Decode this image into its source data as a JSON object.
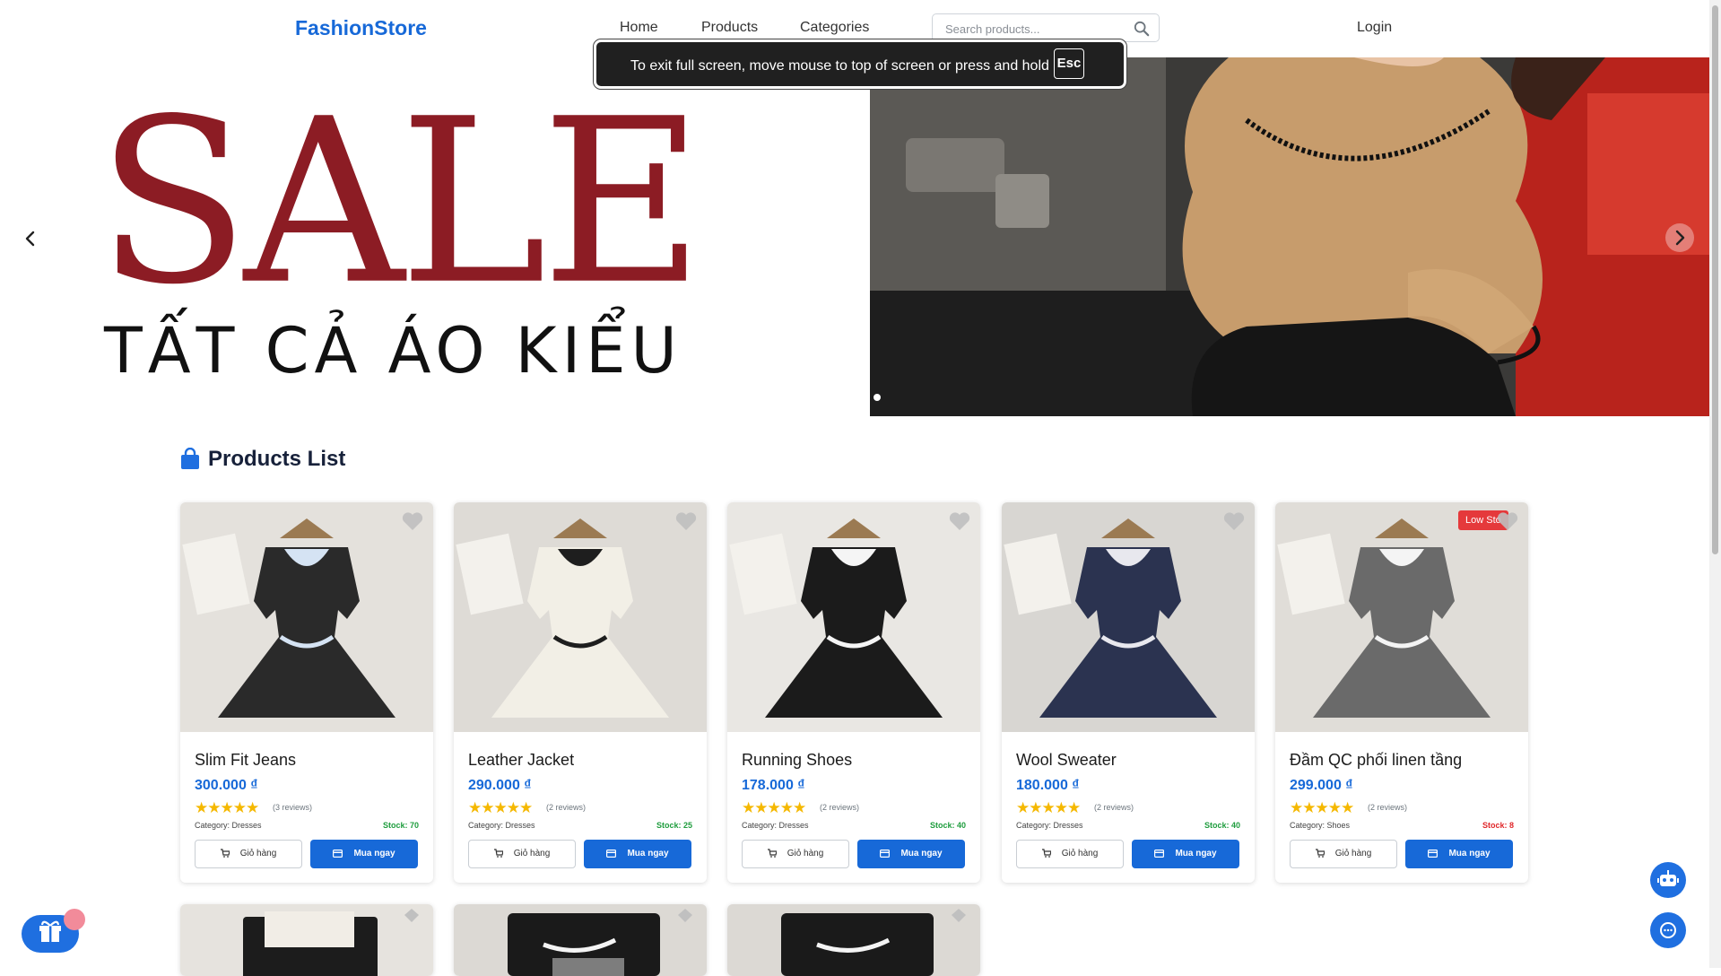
{
  "header": {
    "logo": "FashionStore",
    "nav": [
      "Home",
      "Products",
      "Categories"
    ],
    "search_placeholder": "Search products...",
    "login": "Login"
  },
  "fullscreen_toast": {
    "text": "To exit full screen, move mouse to top of screen or press and hold",
    "key": "Esc"
  },
  "banner": {
    "headline": "SALE",
    "subline": "TẤT CẢ ÁO KIỂU",
    "headline_color": "#8c1c24",
    "active_slide": 1
  },
  "products_section": {
    "title": "Products List",
    "cart_label": "Giỏ hàng",
    "buy_label": "Mua ngay",
    "products": [
      {
        "name": "Slim Fit Jeans",
        "price": "300.000 ₫",
        "stars": "★★★★★",
        "reviews": "(3 reviews)",
        "category": "Category: Dresses",
        "stock": "Stock: 70",
        "low_stock": false
      },
      {
        "name": "Leather Jacket",
        "price": "290.000 ₫",
        "stars": "★★★★★",
        "reviews": "(2 reviews)",
        "category": "Category: Dresses",
        "stock": "Stock: 25",
        "low_stock": false
      },
      {
        "name": "Running Shoes",
        "price": "178.000 ₫",
        "stars": "★★★★★",
        "reviews": "(2 reviews)",
        "category": "Category: Dresses",
        "stock": "Stock: 40",
        "low_stock": false
      },
      {
        "name": "Wool Sweater",
        "price": "180.000 ₫",
        "stars": "★★★★★",
        "reviews": "(2 reviews)",
        "category": "Category: Dresses",
        "stock": "Stock: 40",
        "low_stock": false
      },
      {
        "name": "Đầm QC phối linen tầng",
        "price": "299.000 ₫",
        "stars": "★★★★★",
        "reviews": "(2 reviews)",
        "category": "Category: Shoes",
        "stock": "Stock: 8",
        "low_stock": true,
        "badge": "Low Sto"
      }
    ]
  },
  "colors": {
    "brand": "#1769d8",
    "star": "#f5b800",
    "stock_ok": "#1f9d3e",
    "stock_low": "#e0282b"
  }
}
